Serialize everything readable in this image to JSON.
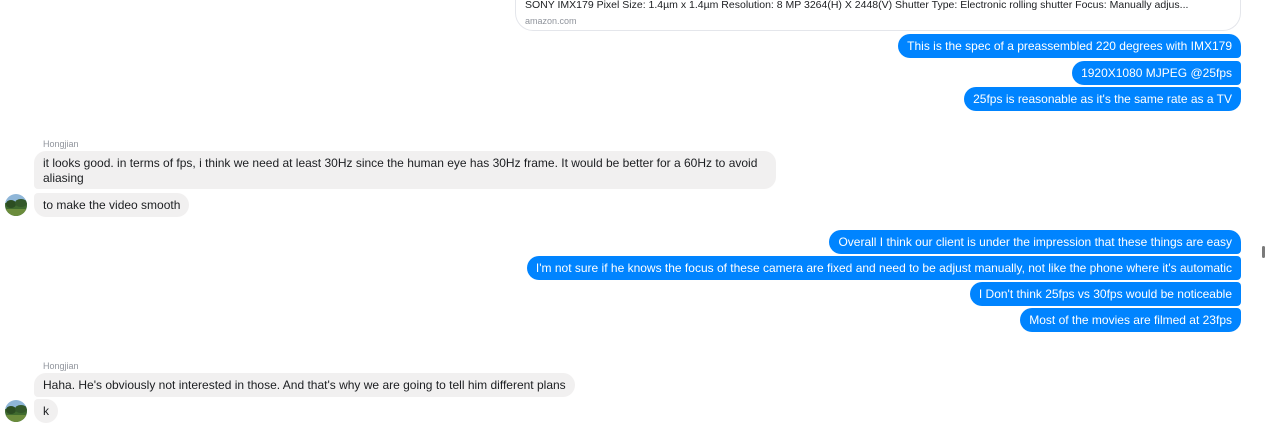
{
  "link_preview": {
    "description": "SONY IMX179 Pixel Size: 1.4µm x 1.4µm Resolution: 8 MP 3264(H) X 2448(V) Shutter Type: Electronic rolling shutter Focus: Manually adjus...",
    "domain": "amazon.com"
  },
  "messages_group1": {
    "m1": "This is the spec of a preassembled 220 degrees with IMX179",
    "m2": "1920X1080 MJPEG @25fps",
    "m3": "25fps is reasonable as it's the same rate as a TV"
  },
  "contact_group1": {
    "sender": "Hongjian",
    "m1": "it looks good. in terms of fps, i think we need at least 30Hz since the human eye has 30Hz frame. It would be better for a 60Hz to avoid aliasing",
    "m2": "to make the video smooth"
  },
  "messages_group2": {
    "m1": "Overall I think our client is under the impression that these things are easy",
    "m2": "I'm not sure if he knows the focus of these camera are fixed and need to be adjust manually, not like the phone where it's automatic",
    "m3": "I Don't think 25fps vs 30fps would be noticeable",
    "m4": "Most of the movies are filmed at 23fps"
  },
  "contact_group2": {
    "sender": "Hongjian",
    "m1": "Haha. He's obviously not interested in those. And that's why we are going to tell him different plans",
    "m2": "k"
  },
  "colors": {
    "outgoing_bubble": "#0084ff",
    "incoming_bubble": "#f1f0f0",
    "sender_label": "#90949c"
  }
}
